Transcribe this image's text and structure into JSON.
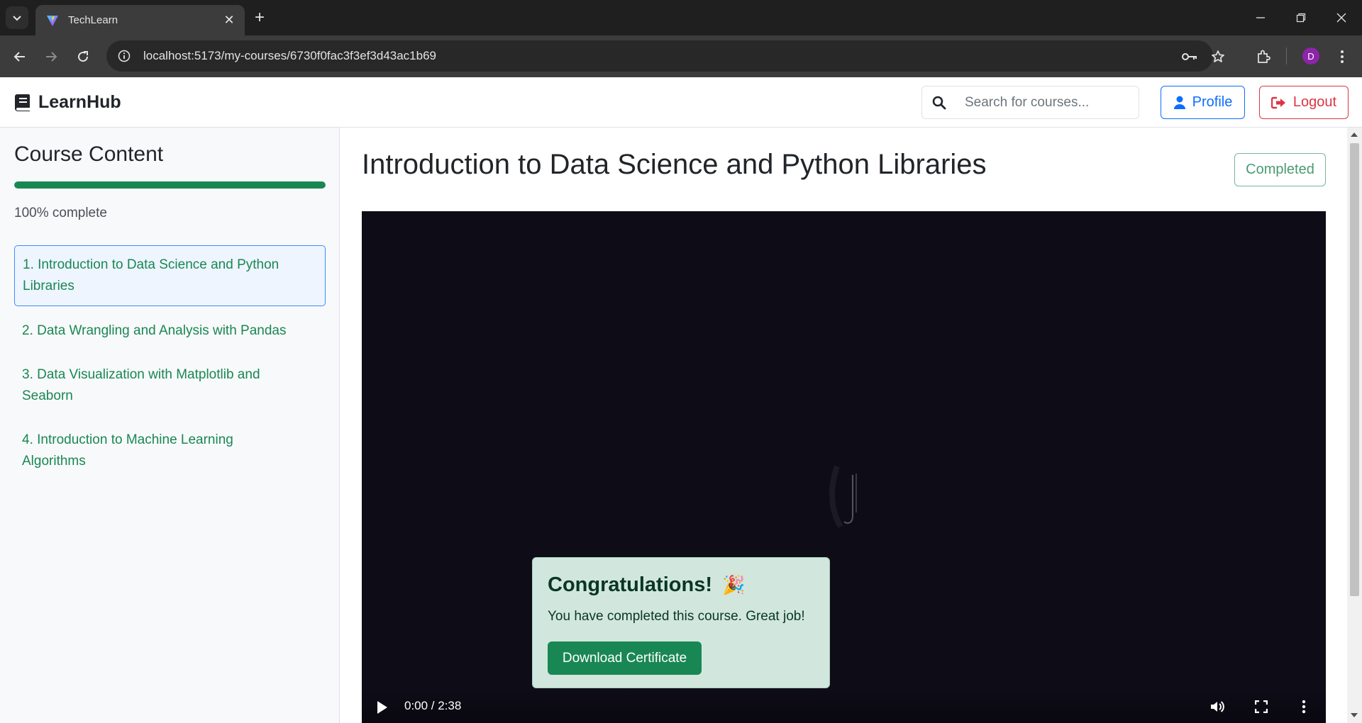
{
  "browser": {
    "tab_title": "TechLearn",
    "url": "localhost:5173/my-courses/6730f0fac3f3ef3d43ac1b69",
    "profile_initial": "D"
  },
  "navbar": {
    "brand": "LearnHub",
    "search_placeholder": "Search for courses...",
    "profile_label": "Profile",
    "logout_label": "Logout"
  },
  "sidebar": {
    "heading": "Course Content",
    "progress_percent": 100,
    "progress_text": "100% complete",
    "lessons": [
      {
        "label": "1. Introduction to Data Science and Python Libraries",
        "active": true
      },
      {
        "label": "2. Data Wrangling and Analysis with Pandas",
        "active": false
      },
      {
        "label": "3. Data Visualization with Matplotlib and Seaborn",
        "active": false
      },
      {
        "label": "4. Introduction to Machine Learning Algorithms",
        "active": false
      }
    ]
  },
  "main": {
    "title": "Introduction to Data Science and Python Libraries",
    "status_badge": "Completed",
    "video": {
      "time": "0:00 / 2:38"
    },
    "congrats": {
      "title": "Congratulations!",
      "emoji": "🎉",
      "message": "You have completed this course. Great job!",
      "button_label": "Download Certificate"
    }
  },
  "colors": {
    "success": "#198754",
    "primary": "#0d6efd",
    "danger": "#dc3545",
    "alert_bg": "#d1e7dd",
    "video_bg": "#0e0c17"
  }
}
